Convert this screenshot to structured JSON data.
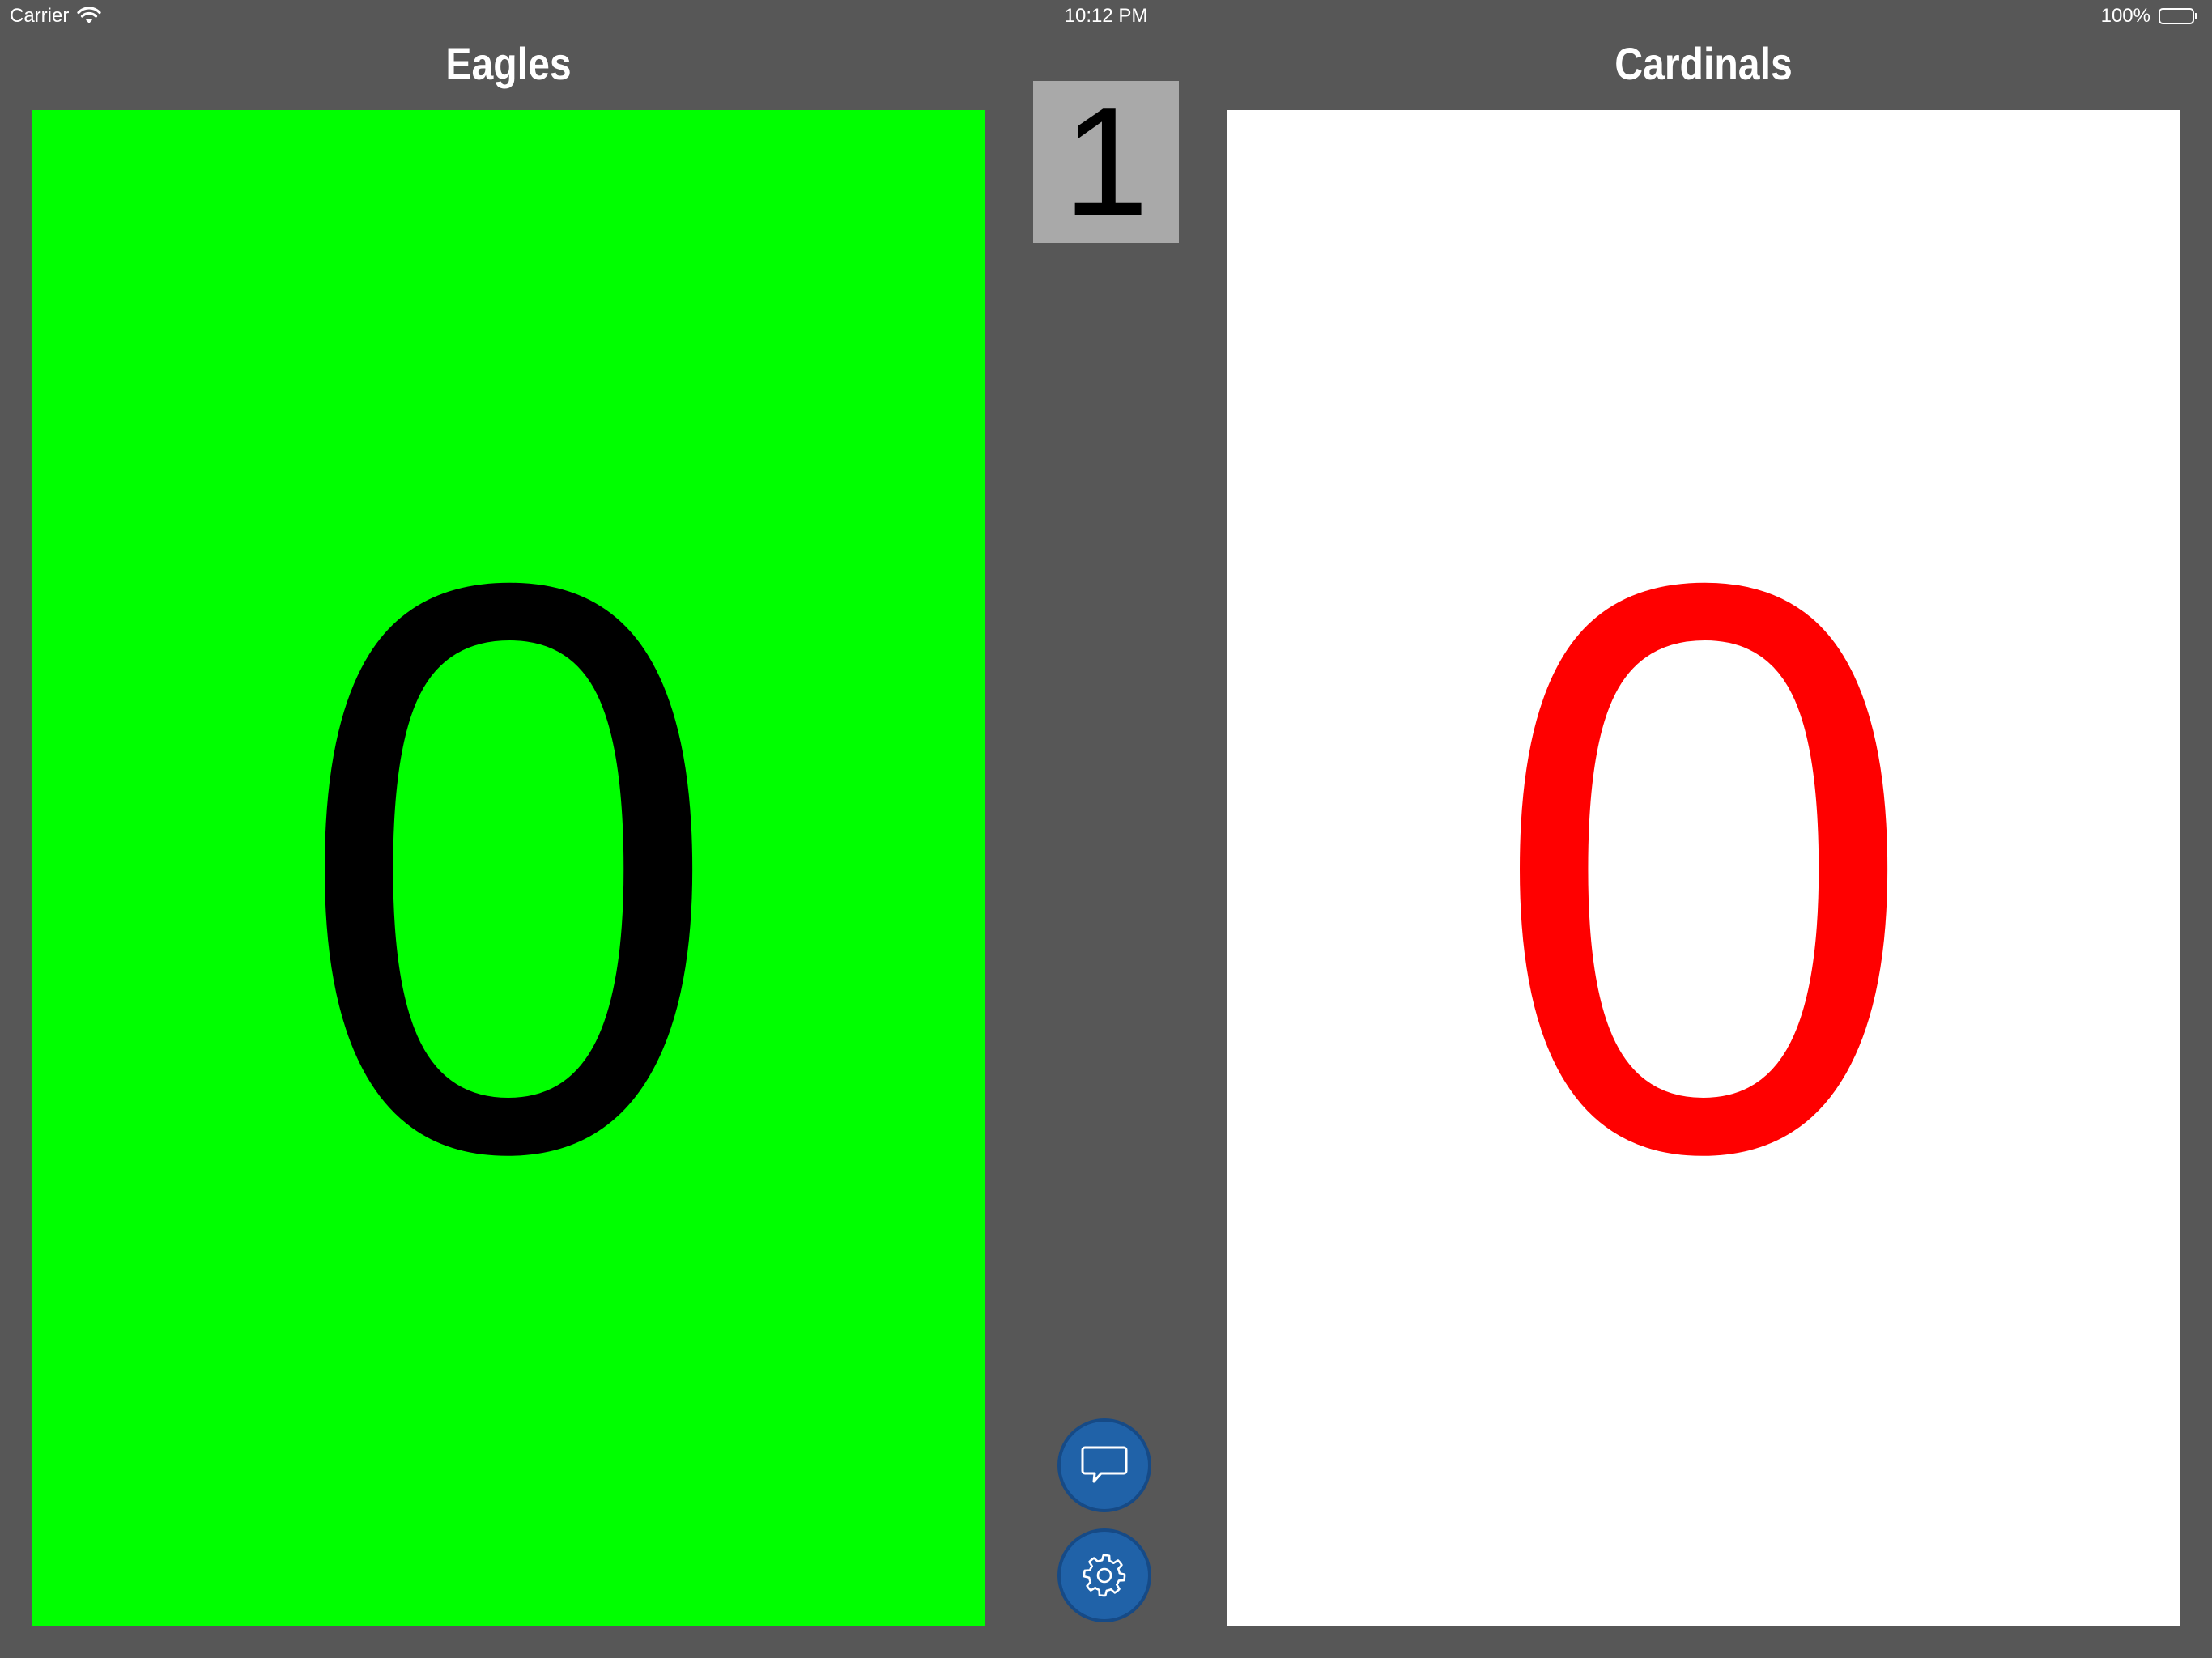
{
  "status_bar": {
    "carrier": "Carrier",
    "time": "10:12 PM",
    "battery": "100%"
  },
  "teams": {
    "left": {
      "name": "Eagles",
      "score": "0",
      "panel_color": "#00ff00",
      "score_color": "#000000"
    },
    "right": {
      "name": "Cardinals",
      "score": "0",
      "panel_color": "#ffffff",
      "score_color": "#ff0000"
    }
  },
  "period": {
    "value": "1",
    "box_color": "#a9a9a9"
  },
  "buttons": {
    "chat_icon": "chat-bubble-icon",
    "settings_icon": "gear-icon",
    "button_color": "#2062a8"
  },
  "colors": {
    "background": "#575757"
  }
}
